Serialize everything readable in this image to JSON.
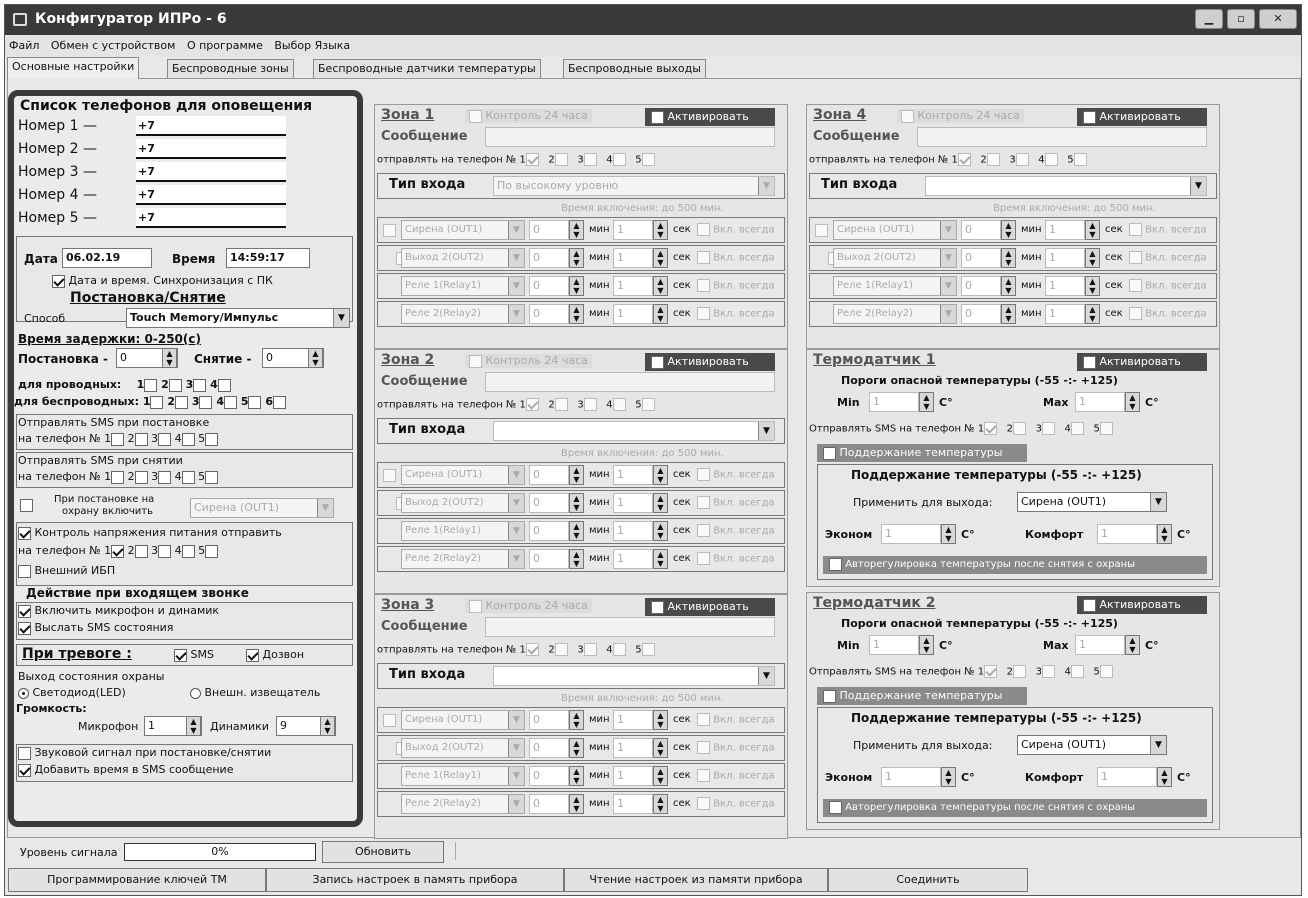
{
  "window": {
    "title": "Конфигуратор ИПРо - 6"
  },
  "menu": [
    "Файл",
    "Обмен с устройством",
    "О программе",
    "Выбор Языка"
  ],
  "tabs": [
    "Основные настройки",
    "Беспроводные зоны",
    "Беспроводные датчики температуры",
    "Беспроводные выходы"
  ],
  "left": {
    "phones_title": "Список телефонов для оповещения",
    "phones": [
      {
        "label": "Номер 1 —",
        "value": "+7"
      },
      {
        "label": "Номер 2 —",
        "value": "+7"
      },
      {
        "label": "Номер 3 —",
        "value": "+7"
      },
      {
        "label": "Номер 4 —",
        "value": "+7"
      },
      {
        "label": "Номер 5 —",
        "value": "+7"
      }
    ],
    "date_label": "Дата",
    "date_value": "06.02.19",
    "time_label": "Время",
    "time_value": "14:59:17",
    "sync_label": "Дата и время. Синхронизация с ПК",
    "arm_title": "Постановка/Снятие",
    "method_label": "Способ",
    "method_value": "Touch Memory/Импульс",
    "delay_title": "Время задержки: 0-250(с)",
    "arm_label": "Постановка -",
    "arm_value": "0",
    "disarm_label": "Снятие -",
    "disarm_value": "0",
    "wired_label": "для проводных:",
    "wired_nums": [
      "1",
      "2",
      "3",
      "4"
    ],
    "wireless_label": "для беспроводных:",
    "wireless_nums": [
      "1",
      "2",
      "3",
      "4",
      "5",
      "6"
    ],
    "sms_arm_title": "Отправлять SMS при постановке",
    "sms_arm_phone": "на телефон №",
    "sms_disarm_title": "Отправлять SMS при снятии",
    "sms_disarm_phone": "на телефон №",
    "phone_nums": [
      "1",
      "2",
      "3",
      "4",
      "5"
    ],
    "on_arm_label_1": "При постановке на",
    "on_arm_label_2": "охрану включить",
    "on_arm_select": "Сирена (OUT1)",
    "voltage_label": "Контроль напряжения питания отправить",
    "voltage_phone": "на телефон №",
    "ups_label": "Внешний ИБП",
    "call_title": "Действие при входящем звонке",
    "call_mic": "Включить микрофон и динамик",
    "call_sms": "Выслать SMS состояния",
    "alarm_label": "При тревоге :",
    "alarm_sms": "SMS",
    "alarm_call": "Дозвон",
    "out_title": "Выход состояния охраны",
    "out_led": "Светодиод(LED)",
    "out_ext": "Внешн. извещатель",
    "volume_title": "Громкость:",
    "mic_label": "Микрофон",
    "mic_value": "1",
    "spk_label": "Динамики",
    "spk_value": "9",
    "sound_label": "Звуковой сигнал при постановке/снятии",
    "addtime_label": "Добавить время в SMS сообщение"
  },
  "zone_common": {
    "ctrl24": "Контроль 24 часа",
    "activate": "Активировать",
    "message": "Сообщение",
    "send_to": "отправлять на телефон №",
    "input_type": "Тип входа",
    "on_time": "Время включения: до 500 мин.",
    "min": "мин",
    "sec": "сек",
    "always": "Вкл. всегда",
    "outputs": [
      "Сирена (OUT1)",
      "Выход 2(OUT2)",
      "Реле 1(Relay1)",
      "Реле 2(Relay2)"
    ],
    "time_value": "0",
    "sec_value": "1"
  },
  "zones": [
    {
      "title": "Зона 1",
      "type_value": "По высокому уровню"
    },
    {
      "title": "Зона 2",
      "type_value": ""
    },
    {
      "title": "Зона 3",
      "type_value": ""
    },
    {
      "title": "Зона 4",
      "type_value": ""
    }
  ],
  "thermo_common": {
    "activate": "Активировать",
    "thresholds": "Пороги опасной температуры (-55 -:- +125)",
    "min": "Min",
    "max": "Max",
    "unit": "C°",
    "sms_to": "Отправлять SMS на телефон №",
    "keep_temp": "Поддержание температуры",
    "keep_title": "Поддержание температуры (-55 -:- +125)",
    "apply_output": "Применить для выхода:",
    "apply_value": "Сирена (OUT1)",
    "econ": "Эконом",
    "comfort": "Комфорт",
    "autoreg": "Авторегулировка температуры после снятия с охраны",
    "value": "1"
  },
  "thermos": [
    {
      "title": "Термодатчик 1"
    },
    {
      "title": "Термодатчик 2"
    }
  ],
  "bottom": {
    "signal_label": "Уровень сигнала",
    "signal_value": "0%",
    "refresh": "Обновить",
    "buttons": [
      "Программирование ключей TM",
      "Запись настроек в память прибора",
      "Чтение настроек из памяти прибора",
      "Соединить"
    ]
  }
}
